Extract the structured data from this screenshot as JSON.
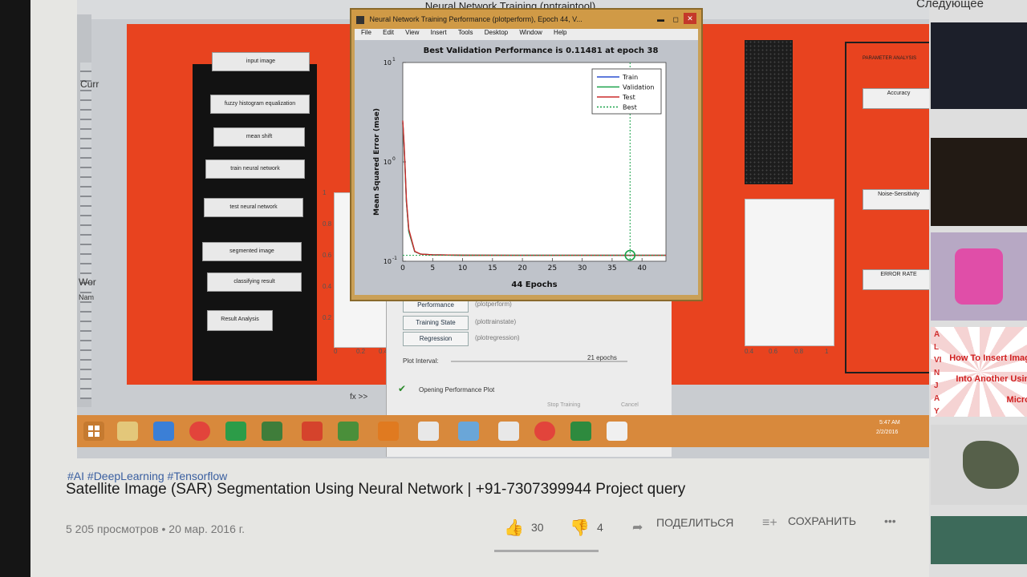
{
  "screen": {
    "window_title": "Neural Network Training (nntraintool)",
    "left_labels": [
      "Curr",
      "Wor",
      "Nam"
    ],
    "status_symbol": "fx >>"
  },
  "gui": {
    "buttons": [
      "input image",
      "fuzzy histogram equalization",
      "mean shift",
      "train neural network",
      "test neural network",
      "segmented image",
      "classifying result",
      "Result Analysis"
    ],
    "plot_y_ticks": [
      "1",
      "0.8",
      "0.6",
      "0.4",
      "0.2"
    ],
    "plot_x_ticks": [
      "0",
      "0.2",
      "0.4",
      "0.6",
      "0.8",
      "1"
    ],
    "right_panel": {
      "title": "PARAMETER ANALYSIS",
      "buttons": [
        "Accuracy",
        "Noise-Sensitivity",
        "ERROR RATE"
      ]
    }
  },
  "nntraintool": {
    "plots": [
      {
        "label": "Performance",
        "hint": "(plotperform)"
      },
      {
        "label": "Training State",
        "hint": "(plottrainstate)"
      },
      {
        "label": "Regression",
        "hint": "(plotregression)"
      }
    ],
    "plot_interval_label": "Plot Interval:",
    "plot_interval_value": "21 epochs",
    "status": "Opening Performance Plot",
    "stop_label": "Stop Training",
    "cancel_label": "Cancel"
  },
  "perf_window": {
    "title": "Neural Network Training Performance (plotperform), Epoch 44, V...",
    "menu": [
      "File",
      "Edit",
      "View",
      "Insert",
      "Tools",
      "Desktop",
      "Window",
      "Help"
    ]
  },
  "chart_data": {
    "type": "line",
    "title": "Best Validation Performance is 0.11481 at epoch 38",
    "xlabel": "44 Epochs",
    "ylabel": "Mean Squared Error  (mse)",
    "xlim": [
      0,
      44
    ],
    "y_scale": "log",
    "ylim": [
      0.1,
      10
    ],
    "x_ticks": [
      0,
      5,
      10,
      15,
      20,
      25,
      30,
      35,
      40
    ],
    "y_tick_labels": [
      "10^1",
      "10^0",
      "10^-1"
    ],
    "series": [
      {
        "name": "Train",
        "color": "#2a4fd0",
        "x": [
          0,
          0.2,
          0.4,
          0.6,
          1,
          2,
          3,
          5,
          10,
          20,
          30,
          38,
          44
        ],
        "values": [
          2.5,
          1.5,
          0.8,
          0.4,
          0.2,
          0.125,
          0.118,
          0.116,
          0.115,
          0.1148,
          0.1148,
          0.1148,
          0.1148
        ]
      },
      {
        "name": "Validation",
        "color": "#1aa24a",
        "x": [
          0,
          0.2,
          0.4,
          0.6,
          1,
          2,
          3,
          5,
          10,
          20,
          30,
          38,
          44
        ],
        "values": [
          2.5,
          1.5,
          0.8,
          0.4,
          0.2,
          0.125,
          0.118,
          0.116,
          0.115,
          0.1148,
          0.1148,
          0.11481,
          0.1148
        ]
      },
      {
        "name": "Test",
        "color": "#cc2b2b",
        "x": [
          0,
          0.2,
          0.4,
          0.6,
          1,
          2,
          3,
          5,
          10,
          20,
          30,
          38,
          44
        ],
        "values": [
          2.6,
          1.6,
          0.85,
          0.42,
          0.21,
          0.126,
          0.118,
          0.116,
          0.115,
          0.1148,
          0.1148,
          0.1148,
          0.1148
        ]
      }
    ],
    "best": {
      "label": "Best",
      "epoch": 38,
      "value": 0.11481
    },
    "legend_position": "top-right",
    "grid": false
  },
  "taskbar": {
    "time": "5:47 AM",
    "date": "2/2/2016"
  },
  "video": {
    "hashtags": "#AI #DeepLearning #Tensorflow",
    "title": "Satellite Image (SAR) Segmentation Using Neural Network | +91-7307399944 Project query",
    "meta": "5 205 просмотров • 20 мар. 2016 г.",
    "likes": "30",
    "dislikes": "4",
    "share_label": "ПОДЕЛИТЬСЯ",
    "save_label": "СОХРАНИТЬ",
    "more_label": "•••"
  },
  "sidebar": {
    "title": "Следующее",
    "thumb_text": "How To Insert Image Into Another Using Micros",
    "thumb_vertical": "ALVINJAY"
  }
}
